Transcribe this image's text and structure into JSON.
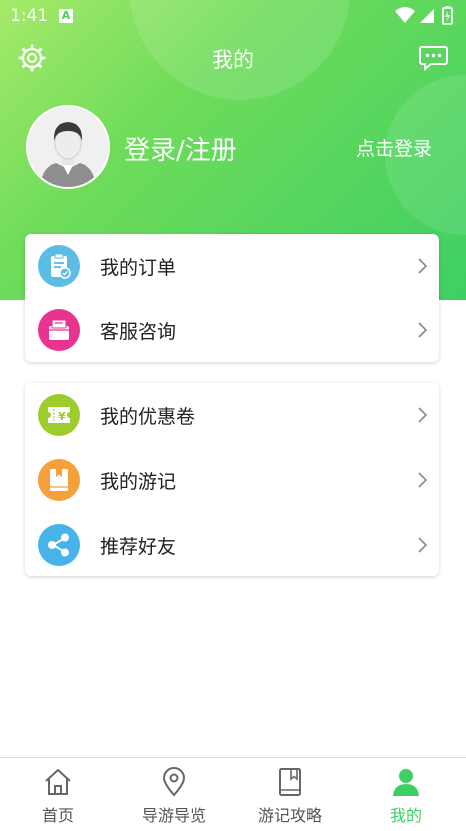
{
  "status_bar": {
    "time": "1:41",
    "notification_badge": "A"
  },
  "header": {
    "title": "我的",
    "login_title": "登录/注册",
    "login_link": "点击登录",
    "gradient_start": "#a6ea6a",
    "gradient_end": "#3ecf63"
  },
  "menu_group_1": [
    {
      "label": "我的订单",
      "icon": "clipboard-icon",
      "color": "#5bbce4"
    },
    {
      "label": "客服咨询",
      "icon": "service-box-icon",
      "color": "#e8338f"
    }
  ],
  "menu_group_2": [
    {
      "label": "我的优惠卷",
      "icon": "coupon-icon",
      "color": "#9ccd2d"
    },
    {
      "label": "我的游记",
      "icon": "travel-notes-icon",
      "color": "#f5a03a"
    },
    {
      "label": "推荐好友",
      "icon": "share-icon",
      "color": "#46b4e8"
    }
  ],
  "tabbar": {
    "active_color": "#3ecf63",
    "items": [
      {
        "label": "首页",
        "icon": "home-icon"
      },
      {
        "label": "导游导览",
        "icon": "location-pin-icon"
      },
      {
        "label": "游记攻略",
        "icon": "book-icon"
      },
      {
        "label": "我的",
        "icon": "profile-icon",
        "active": true
      }
    ]
  }
}
